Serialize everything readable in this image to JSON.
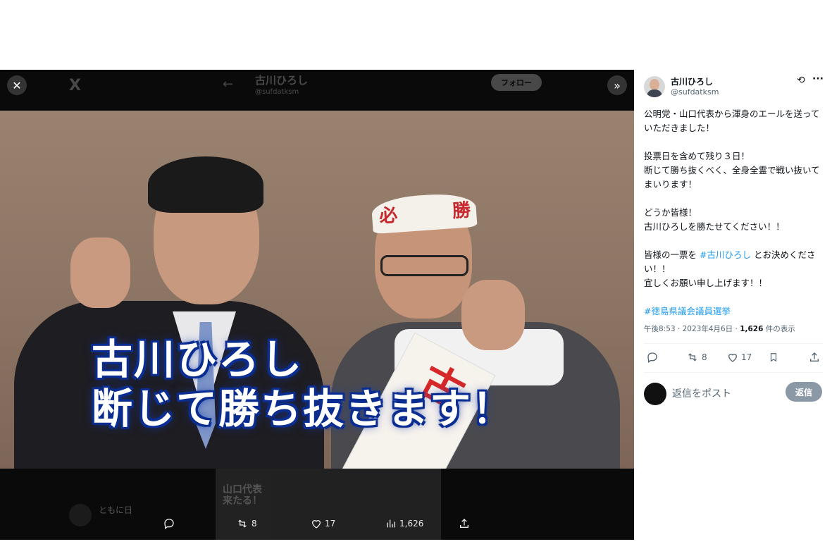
{
  "viewer": {
    "close_icon": "close-icon",
    "expand_icon": "chevron-double-right-icon",
    "ghost": {
      "logo": "X",
      "title": "古川ひろし",
      "subtitle": "@sufdatksm",
      "follow_label": "フォロー",
      "bottom_name": "ともに日",
      "bottom_image_text": "山口代表\n来たる！"
    },
    "caption_line1": "古川ひろし",
    "caption_line2": "断じて勝ち抜きます！",
    "headband_left": "必",
    "headband_right": "勝",
    "sash_text": "古",
    "actions": {
      "reply_count": "",
      "retweet_count": "8",
      "like_count": "17",
      "views_count": "1,626"
    }
  },
  "tweet": {
    "display_name": "古川ひろし",
    "handle": "@sufdatksm",
    "paragraph1": "公明党・山口代表から渾身のエールを送っていただきました！",
    "paragraph2": "投票日を含めて残り３日！\n断じて勝ち抜くべく、全身全霊で戦い抜いてまいります！",
    "paragraph3": "どうか皆様！\n古川ひろしを勝たせてください！！",
    "paragraph4_pre": "皆様の一票を ",
    "paragraph4_link": "#古川ひろし",
    "paragraph4_post": " とお決めください！！\n宜しくお願い申し上げます！！",
    "hashtag": "#徳島県議会議員選挙",
    "time": "午後8:53 · 2023年4月6日 · ",
    "views_number": "1,626",
    "views_label": " 件の表示",
    "retweet_count": "8",
    "like_count": "17"
  },
  "reply": {
    "placeholder": "返信をポスト",
    "button_label": "返信"
  },
  "colors": {
    "link": "#1d9bf0",
    "caption_outline": "#0b2f95",
    "reply_button": "#8b98a5"
  }
}
